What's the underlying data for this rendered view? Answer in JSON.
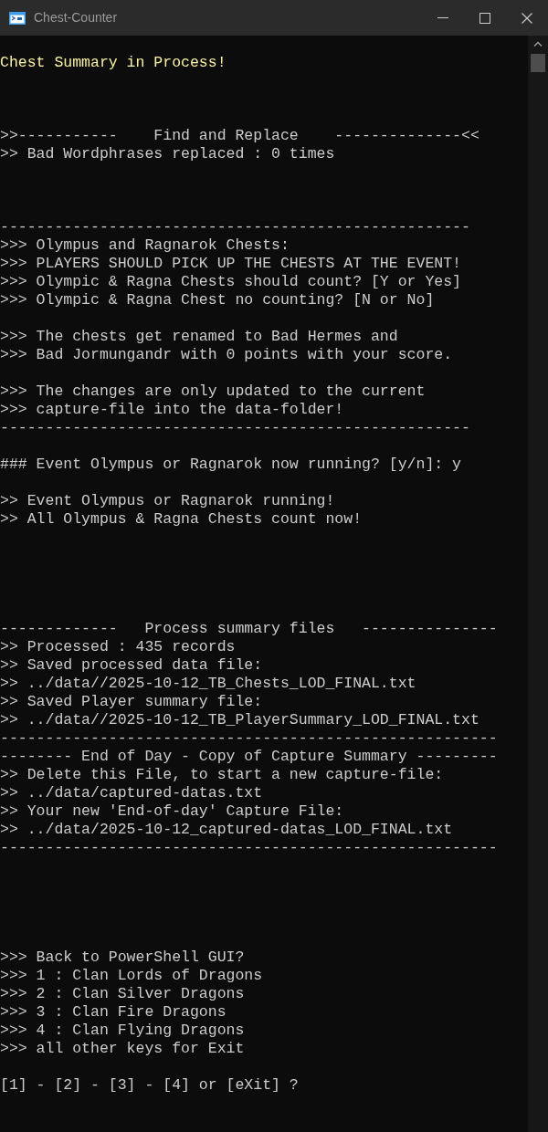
{
  "window": {
    "title": "Chest-Counter"
  },
  "console": {
    "groups": [
      {
        "lines": [
          {
            "kind": "highlight",
            "text": "Chest Summary in Process!"
          }
        ]
      },
      {
        "lines": [
          {
            "kind": "plain",
            "text": ">>-----------    Find and Replace    --------------<<"
          },
          {
            "kind": "plain",
            "text": ">> Bad Wordphrases replaced : 0 times"
          }
        ]
      },
      {
        "lines": [
          {
            "kind": "plain",
            "text": "----------------------------------------------------"
          },
          {
            "kind": "plain",
            "text": ">>> Olympus and Ragnarok Chests:"
          },
          {
            "kind": "plain",
            "text": ">>> PLAYERS SHOULD PICK UP THE CHESTS AT THE EVENT!"
          },
          {
            "kind": "plain",
            "text": ">>> Olympic & Ragna Chests should count? [Y or Yes]"
          },
          {
            "kind": "plain",
            "text": ">>> Olympic & Ragna Chest no counting? [N or No]"
          }
        ]
      },
      {
        "lines": [
          {
            "kind": "plain",
            "text": ">>> The chests get renamed to Bad Hermes and"
          },
          {
            "kind": "plain",
            "text": ">>> Bad Jormungandr with 0 points with your score."
          }
        ]
      },
      {
        "lines": [
          {
            "kind": "plain",
            "text": ">>> The changes are only updated to the current"
          },
          {
            "kind": "plain",
            "text": ">>> capture-file into the data-folder!"
          },
          {
            "kind": "plain",
            "text": "----------------------------------------------------"
          }
        ]
      },
      {
        "lines": [
          {
            "kind": "plain",
            "text": "### Event Olympus or Ragnarok now running? [y/n]: y"
          }
        ]
      },
      {
        "lines": [
          {
            "kind": "plain",
            "text": ">> Event Olympus or Ragnarok running!"
          },
          {
            "kind": "plain",
            "text": ">> All Olympus & Ragna Chests count now!"
          }
        ]
      },
      {
        "lines": [
          {
            "kind": "plain",
            "text": "-------------   Process summary files   ---------------"
          },
          {
            "kind": "plain",
            "text": ">> Processed : 435 records"
          },
          {
            "kind": "plain",
            "text": ">> Saved processed data file:"
          },
          {
            "kind": "plain",
            "text": ">> ../data//2025-10-12_TB_Chests_LOD_FINAL.txt"
          },
          {
            "kind": "plain",
            "text": ">> Saved Player summary file:"
          },
          {
            "kind": "plain",
            "text": ">> ../data//2025-10-12_TB_PlayerSummary_LOD_FINAL.txt"
          },
          {
            "kind": "plain",
            "text": "-------------------------------------------------------"
          },
          {
            "kind": "plain",
            "text": "-------- End of Day - Copy of Capture Summary ---------"
          },
          {
            "kind": "plain",
            "text": ">> Delete this File, to start a new capture-file:"
          },
          {
            "kind": "plain",
            "text": ">> ../data/captured-datas.txt"
          },
          {
            "kind": "plain",
            "text": ">> Your new 'End-of-day' Capture File:"
          },
          {
            "kind": "plain",
            "text": ">> ../data/2025-10-12_captured-datas_LOD_FINAL.txt"
          },
          {
            "kind": "plain",
            "text": "-------------------------------------------------------"
          }
        ]
      },
      {
        "lines": [
          {
            "kind": "plain",
            "text": ">>> Back to PowerShell GUI?"
          },
          {
            "kind": "plain",
            "text": ">>> 1 : Clan Lords of Dragons"
          },
          {
            "kind": "plain",
            "text": ">>> 2 : Clan Silver Dragons"
          },
          {
            "kind": "plain",
            "text": ">>> 3 : Clan Fire Dragons"
          },
          {
            "kind": "plain",
            "text": ">>> 4 : Clan Flying Dragons"
          },
          {
            "kind": "plain",
            "text": ">>> all other keys for Exit"
          }
        ]
      },
      {
        "lines": [
          {
            "kind": "plain",
            "text": "[1] - [2] - [3] - [4] or [eXit] ?"
          }
        ]
      }
    ]
  }
}
